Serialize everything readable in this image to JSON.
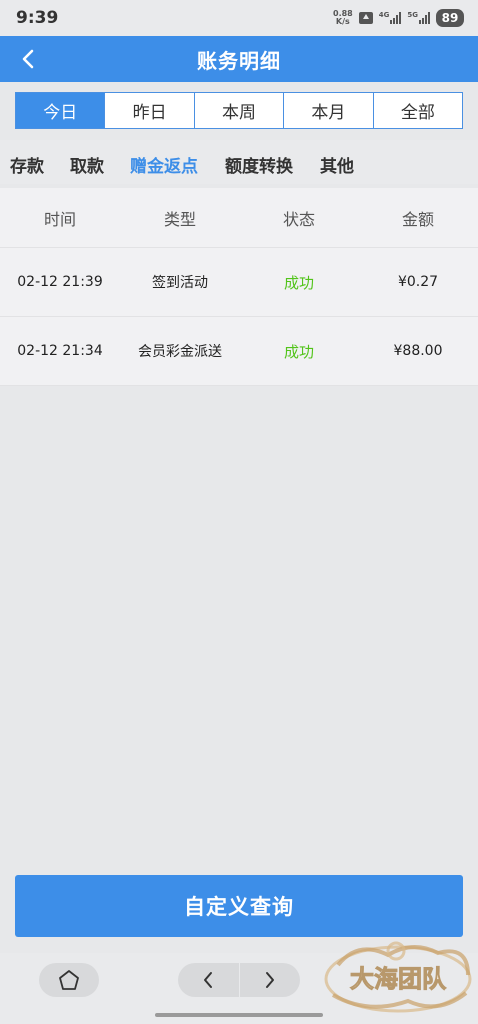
{
  "status_bar": {
    "time": "9:39",
    "net_speed_value": "0.88",
    "net_speed_unit": "K/s",
    "sim1_tag": "4G",
    "sim2_tag": "5G",
    "battery": "89"
  },
  "header": {
    "title": "账务明细",
    "back_icon": "chevron-left-icon"
  },
  "period_tabs": [
    {
      "label": "今日",
      "active": true
    },
    {
      "label": "昨日",
      "active": false
    },
    {
      "label": "本周",
      "active": false
    },
    {
      "label": "本月",
      "active": false
    },
    {
      "label": "全部",
      "active": false
    }
  ],
  "category_tabs": [
    {
      "label": "存款",
      "active": false
    },
    {
      "label": "取款",
      "active": false
    },
    {
      "label": "赠金返点",
      "active": true
    },
    {
      "label": "额度转换",
      "active": false
    },
    {
      "label": "其他",
      "active": false
    }
  ],
  "table": {
    "columns": [
      "时间",
      "类型",
      "状态",
      "金额"
    ],
    "rows": [
      {
        "time": "02-12 21:39",
        "type": "签到活动",
        "status": "成功",
        "amount": "¥0.27"
      },
      {
        "time": "02-12 21:34",
        "type": "会员彩金派送",
        "status": "成功",
        "amount": "¥88.00"
      }
    ]
  },
  "query_button": {
    "label": "自定义查询"
  },
  "bottom_bar": {
    "home_icon": "home-icon",
    "back_icon": "chevron-left-icon",
    "forward_icon": "chevron-right-icon"
  },
  "watermark": {
    "text": "大海团队"
  },
  "colors": {
    "accent": "#3d8ee8",
    "success": "#52c41a",
    "background": "#e7e8ea"
  }
}
